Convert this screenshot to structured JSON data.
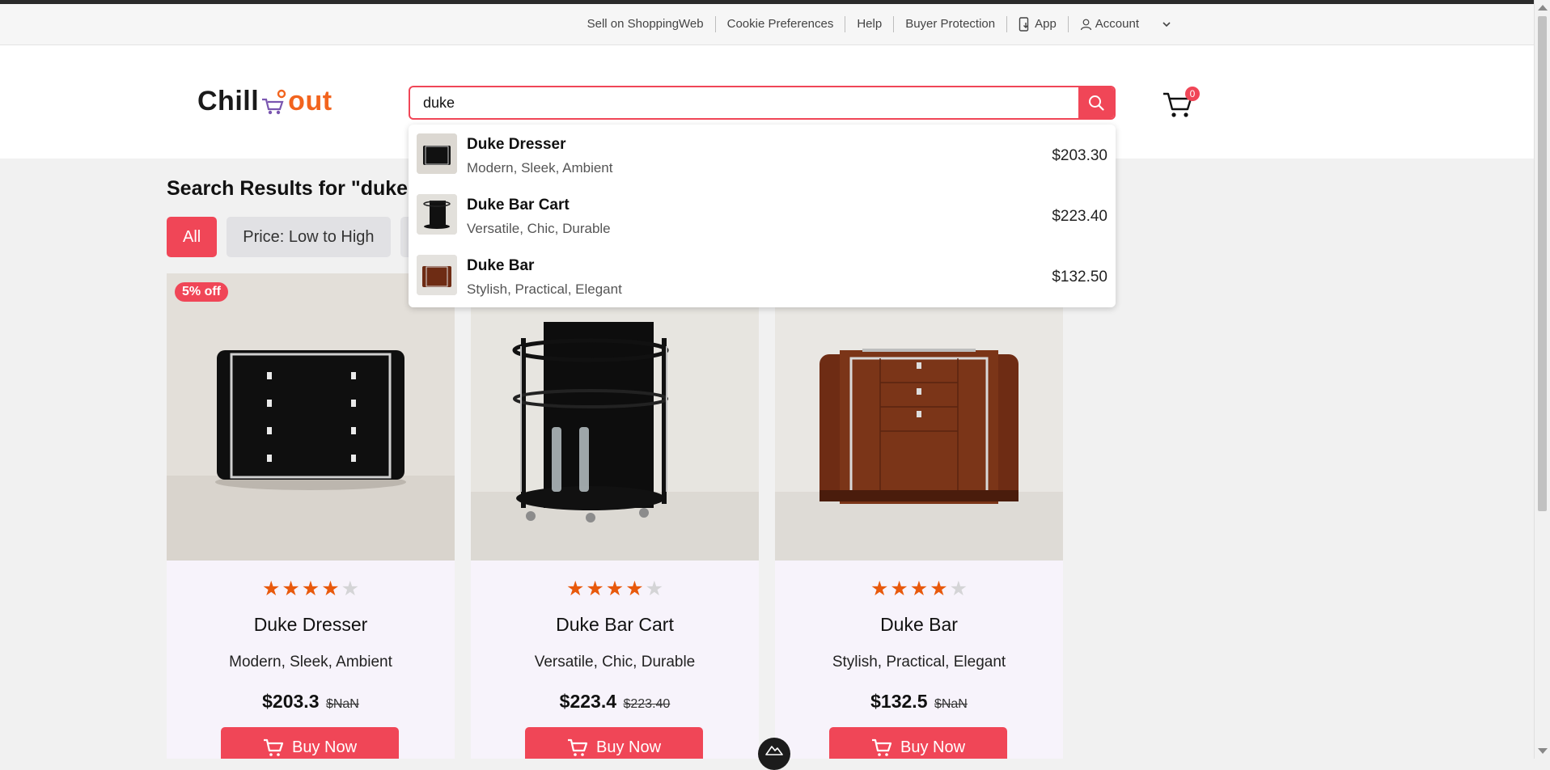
{
  "utility": {
    "links": [
      "Sell on ShoppingWeb",
      "Cookie Preferences",
      "Help",
      "Buyer Protection",
      "App",
      "Account"
    ]
  },
  "logo": {
    "part1": "Chill",
    "part2": "out"
  },
  "search": {
    "value": "duke",
    "placeholder": ""
  },
  "cart": {
    "count": "0"
  },
  "results": {
    "title": "Search Results for \"duke\""
  },
  "filters": [
    "All",
    "Price: Low to High"
  ],
  "suggestions": [
    {
      "name": "Duke Dresser",
      "desc": "Modern, Sleek, Ambient",
      "price": "$203.30"
    },
    {
      "name": "Duke Bar Cart",
      "desc": "Versatile, Chic, Durable",
      "price": "$223.40"
    },
    {
      "name": "Duke Bar",
      "desc": "Stylish, Practical, Elegant",
      "price": "$132.50"
    }
  ],
  "products": [
    {
      "name": "Duke Dresser",
      "desc": "Modern, Sleek, Ambient",
      "price": "$203.3",
      "old_price": "$NaN",
      "badge": "5% off",
      "rating": 4,
      "buy": "Buy Now"
    },
    {
      "name": "Duke Bar Cart",
      "desc": "Versatile, Chic, Durable",
      "price": "$223.4",
      "old_price": "$223.40",
      "rating": 4,
      "buy": "Buy Now"
    },
    {
      "name": "Duke Bar",
      "desc": "Stylish, Practical, Elegant",
      "price": "$132.5",
      "old_price": "$NaN",
      "rating": 4,
      "buy": "Buy Now"
    }
  ],
  "icons": {
    "search": "search-icon",
    "cart": "cart-icon",
    "app": "phone-download-icon",
    "account": "user-icon",
    "chevron": "chevron-down-icon",
    "buy": "cart-icon",
    "star": "star-icon"
  },
  "colors": {
    "accent": "#f04657",
    "logo_orange": "#f2641e",
    "star": "#e8590c"
  }
}
